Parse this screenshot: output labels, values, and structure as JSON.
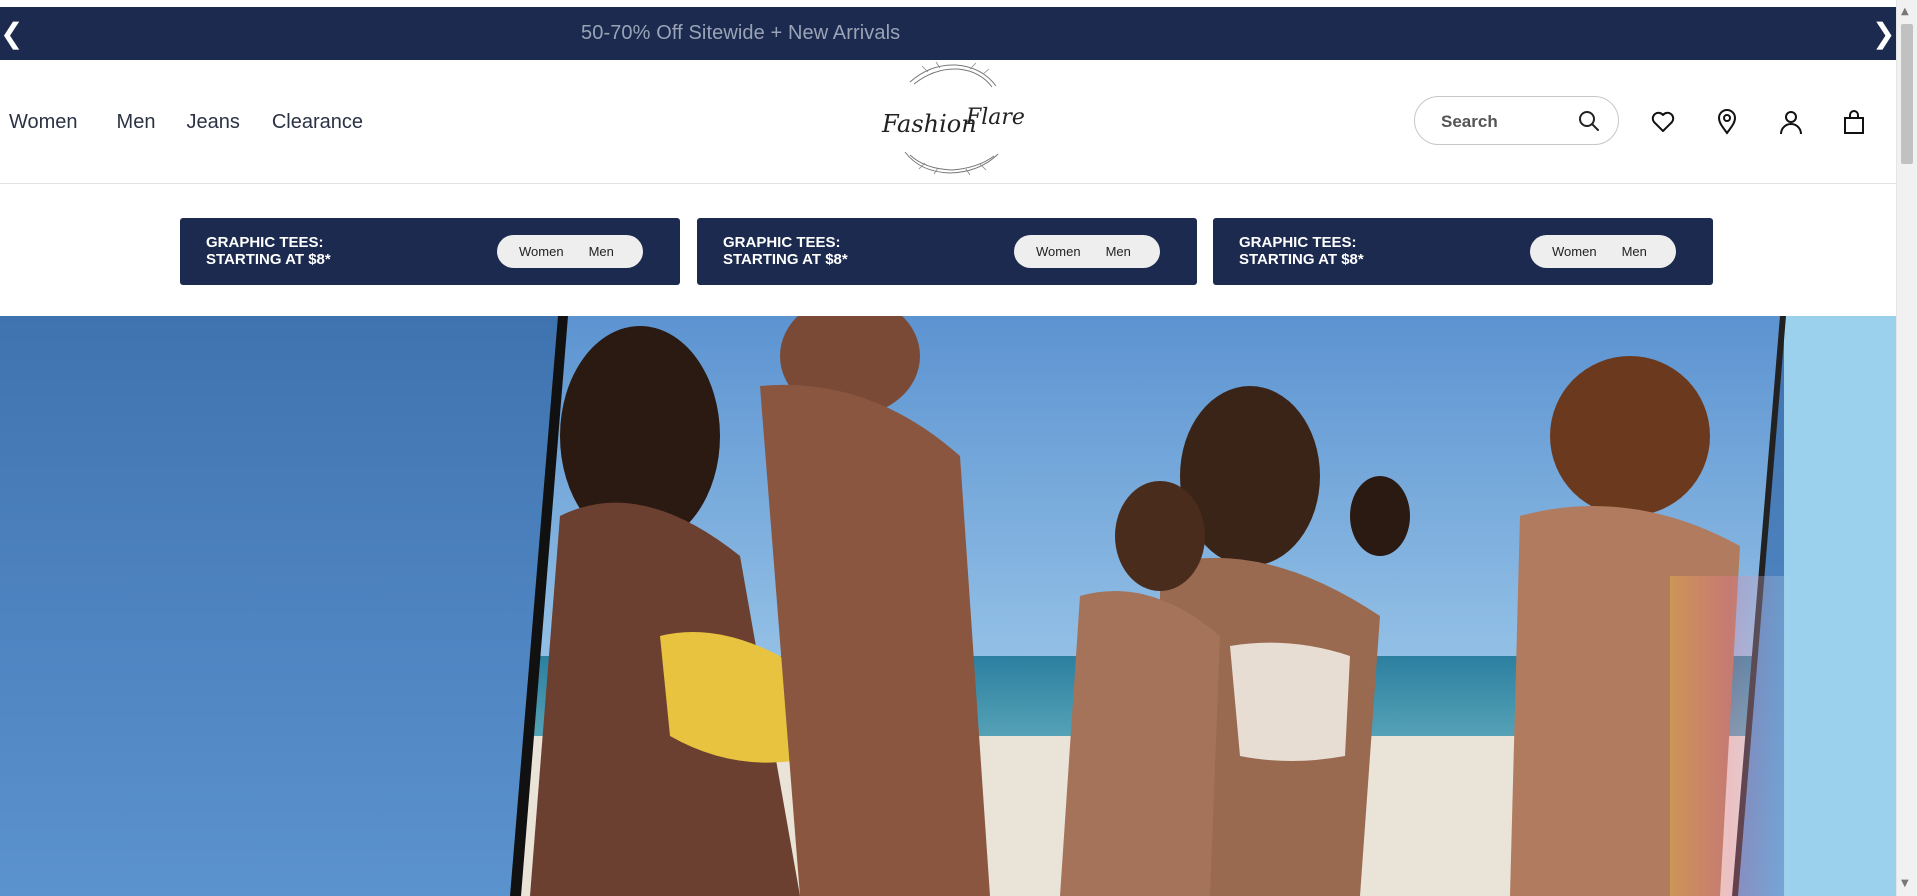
{
  "announcement": {
    "text": "50-70% Off Sitewide + New Arrivals",
    "prev_icon": "chevron-left-icon",
    "next_icon": "chevron-right-icon",
    "prev_glyph": "❮",
    "next_glyph": "❯"
  },
  "nav": {
    "items": [
      "Women",
      "Men",
      "Jeans",
      "Clearance"
    ]
  },
  "logo": {
    "text_line1": "Fashion",
    "text_line2": "Flare"
  },
  "search": {
    "placeholder": "Search"
  },
  "header_icons": [
    "heart-icon",
    "location-pin-icon",
    "account-icon",
    "shopping-bag-icon"
  ],
  "promos": [
    {
      "title": "GRAPHIC TEES:\nSTARTING AT $8*",
      "links": [
        "Women",
        "Men"
      ]
    },
    {
      "title": "GRAPHIC TEES:\nSTARTING AT $8*",
      "links": [
        "Women",
        "Men"
      ]
    },
    {
      "title": "GRAPHIC TEES:\nSTARTING AT $8*",
      "links": [
        "Women",
        "Men"
      ]
    }
  ],
  "colors": {
    "navy": "#1b2a4e",
    "announcement_text": "#9aa3b6"
  }
}
